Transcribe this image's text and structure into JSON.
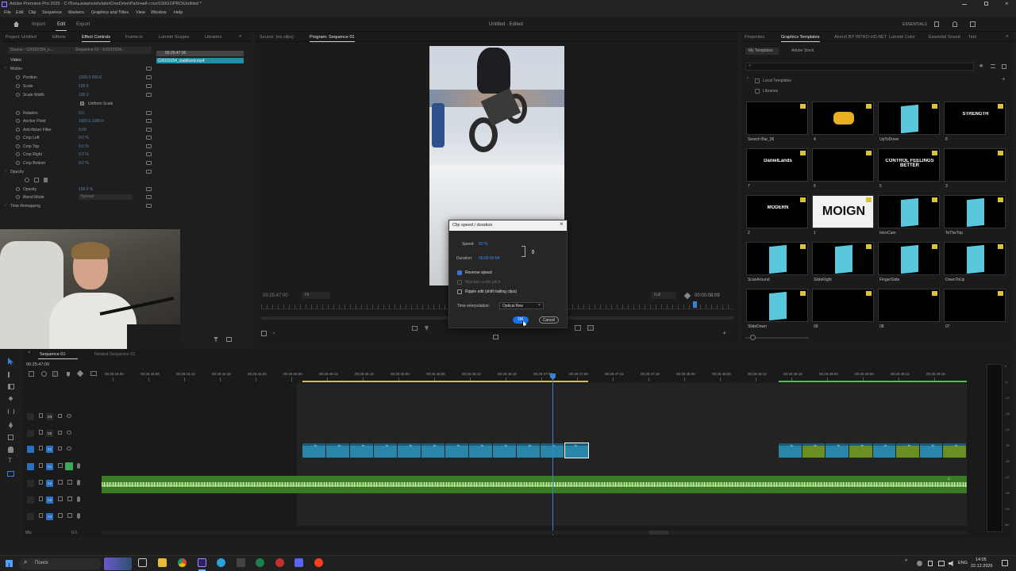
{
  "titlebar": {
    "title": "Adobe Premiere Pro 2025 - C:\\Пользователи\\vlatin\\OneDrive\\Рабочий стол\\100GOPRO\\Untitled *"
  },
  "menu": [
    "File",
    "Edit",
    "Clip",
    "Sequence",
    "Markers",
    "Graphics and Titles",
    "View",
    "Window",
    "Help"
  ],
  "workspace": {
    "tabs": [
      "Import",
      "Edit",
      "Export"
    ],
    "doc_title": "Untitled - Edited",
    "essentials": "ESSENTIALS"
  },
  "left_panel": {
    "tabs": [
      "Project: Untitled",
      "Effects",
      "Effect Controls",
      "Frame.io",
      "Lumetri Scopes",
      "Libraries"
    ],
    "source_label": "Source - GX010154_s...",
    "seq_label": "Sequence 01 - GX010154...",
    "time": "00:25:47:00",
    "clip_name": "GX010154_stabilized.mp4",
    "section_video": "Video",
    "rows": [
      {
        "label": "Motion",
        "value": "",
        "indent": 1
      },
      {
        "label": "Position",
        "value": "1260.0   960.0",
        "indent": 2
      },
      {
        "label": "Scale",
        "value": "100.0",
        "indent": 2
      },
      {
        "label": "Scale Width",
        "value": "100.0",
        "indent": 2
      },
      {
        "label": "Uniform Scale",
        "value": "",
        "indent": 3
      },
      {
        "label": "Rotation",
        "value": "0.0",
        "indent": 2
      },
      {
        "label": "Anchor Point",
        "value": "1920.0   1080.0",
        "indent": 2
      },
      {
        "label": "Anti-flicker Filter",
        "value": "0.00",
        "indent": 2
      },
      {
        "label": "Crop Left",
        "value": "0.0 %",
        "indent": 2
      },
      {
        "label": "Crop Top",
        "value": "0.0 %",
        "indent": 2
      },
      {
        "label": "Crop Right",
        "value": "0.0 %",
        "indent": 2
      },
      {
        "label": "Crop Bottom",
        "value": "0.0 %",
        "indent": 2
      },
      {
        "label": "Opacity",
        "value": "",
        "indent": 1
      },
      {
        "label": "",
        "value": "",
        "indent": 2
      },
      {
        "label": "Opacity",
        "value": "100.0 %",
        "indent": 2
      },
      {
        "label": "Blend Mode",
        "value": "Normal",
        "indent": 2
      },
      {
        "label": "Time Remapping",
        "value": "",
        "indent": 1
      }
    ]
  },
  "program": {
    "tabs": [
      "Source: (no clips)",
      "Program: Sequence 01"
    ],
    "timecode_left": "00:25:47:00",
    "fit": "Fit",
    "full": "Full",
    "timecode_right": "00:00:08:09"
  },
  "dialog": {
    "title": "Clip speed / duration",
    "speed_label": "Speed:",
    "speed_value": "50 %",
    "duration_label": "Duration:",
    "duration_value": "00:00:00:04",
    "reverse": "Reverse speed",
    "maintain": "Maintain audio pitch",
    "ripple": "Ripple edit (shift trailing clips)",
    "interp_label": "Time interpolation:",
    "interp_value": "Optical flow",
    "ok": "OK",
    "cancel": "Cancel"
  },
  "right_panel": {
    "tabs": [
      "Properties",
      "Graphics Templates",
      "AtomX BY INTRO-HD.NET",
      "Lumetri Color",
      "Essential Sound",
      "Text"
    ],
    "subtabs": [
      "My Templates",
      "Adobe Stock"
    ],
    "local": "Local Templates",
    "libraries": "Libraries",
    "templates": [
      {
        "label": "Search Bar_06",
        "kind": "dark",
        "text": ""
      },
      {
        "label": "4",
        "kind": "yellow",
        "text": ""
      },
      {
        "label": "UpToDown",
        "kind": "cyan",
        "text": ""
      },
      {
        "label": "8",
        "kind": "dark",
        "text": "STRENGTH"
      },
      {
        "label": "7",
        "kind": "dark",
        "text": "DanielLands"
      },
      {
        "label": "6",
        "kind": "dark",
        "text": ""
      },
      {
        "label": "5",
        "kind": "dark",
        "text": "CONTROL FEELINGS BETTER"
      },
      {
        "label": "3",
        "kind": "dark",
        "text": ""
      },
      {
        "label": "2",
        "kind": "dark",
        "text": "MODERN"
      },
      {
        "label": "1",
        "kind": "white",
        "text": "MOIGN"
      },
      {
        "label": "IntroCam",
        "kind": "cyan",
        "text": ""
      },
      {
        "label": "ToTheTop",
        "kind": "cyan",
        "text": ""
      },
      {
        "label": "ScanAround",
        "kind": "cyan",
        "text": ""
      },
      {
        "label": "SlideRight",
        "kind": "cyan",
        "text": ""
      },
      {
        "label": "FingerSlide",
        "kind": "cyan",
        "text": ""
      },
      {
        "label": "DownToUp",
        "kind": "cyan",
        "text": ""
      },
      {
        "label": "SlideDown",
        "kind": "cyan",
        "text": ""
      },
      {
        "label": "09",
        "kind": "dark",
        "text": ""
      },
      {
        "label": "08",
        "kind": "dark",
        "text": ""
      },
      {
        "label": "07",
        "kind": "dark",
        "text": ""
      }
    ]
  },
  "timeline": {
    "tabs": [
      "Sequence 01",
      "Nested Sequence 01"
    ],
    "timecode": "00:25:47:00",
    "ruler": [
      "00:25:44:00",
      "00:25:44:06",
      "00:25:44:12",
      "00:25:44:18",
      "00:25:45:00",
      "00:25:45:06",
      "00:25:45:12",
      "00:25:45:18",
      "00:25:46:00",
      "00:25:46:06",
      "00:25:46:12",
      "00:25:46:18",
      "00:25:47:00",
      "00:25:47:06",
      "00:25:47:12",
      "00:25:47:18",
      "00:25:48:00",
      "00:25:48:06",
      "00:25:48:12",
      "00:25:48:18",
      "00:25:49:00",
      "00:25:49:06",
      "00:25:49:12",
      "00:25:49:18"
    ],
    "tracks": [
      {
        "id": "V3",
        "kind": "video"
      },
      {
        "id": "V2",
        "kind": "video"
      },
      {
        "id": "V1",
        "kind": "video"
      },
      {
        "id": "A1",
        "kind": "audio"
      },
      {
        "id": "A2",
        "kind": "audio"
      },
      {
        "id": "A3",
        "kind": "audio"
      },
      {
        "id": "A4",
        "kind": "audio"
      },
      {
        "id": "Mix",
        "kind": "mix"
      }
    ],
    "mix_value": "0.0",
    "meter_db": [
      "0",
      "-6",
      "-12",
      "-18",
      "-24",
      "-30",
      "-36",
      "-42",
      "-48",
      "-54",
      "dB"
    ]
  },
  "taskbar": {
    "search": "Поиск",
    "lang": "ENG",
    "time": "14:05",
    "date": "22.12.2025"
  },
  "colors": {
    "accent": "#1473e6",
    "clip": "#2a86a8",
    "audio": "#4c8a2f",
    "playhead": "#3a7fd6"
  }
}
